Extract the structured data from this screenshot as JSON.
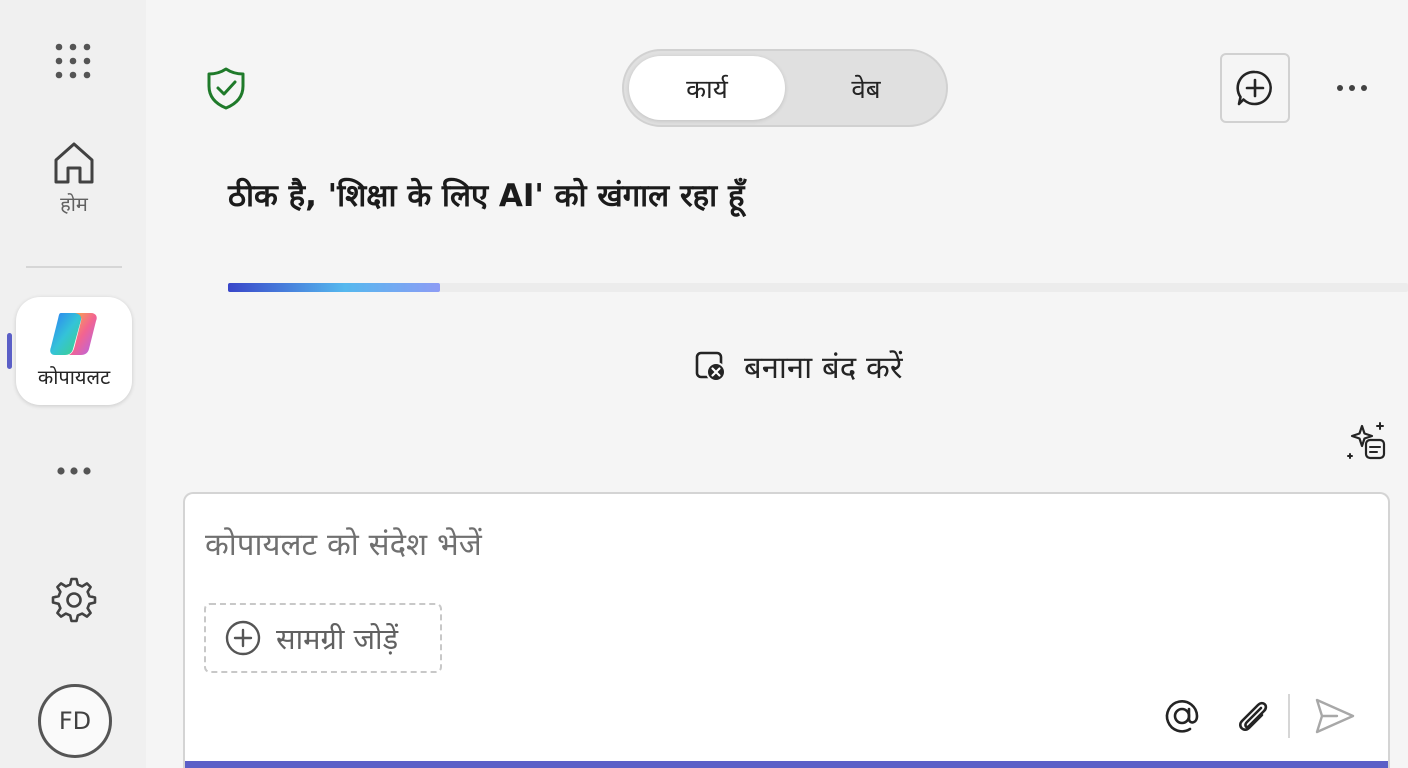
{
  "rail": {
    "home_label": "होम",
    "copilot_label": "कोपायलट",
    "avatar_initials": "FD",
    "accent_color": "#5b5fc7"
  },
  "header": {
    "tabs": [
      {
        "label": "कार्य",
        "selected": true
      },
      {
        "label": "वेब",
        "selected": false
      }
    ],
    "shield_color": "#1f7a2a"
  },
  "status": {
    "text": "ठीक है, 'शिक्षा के लिए AI' को खंगाल रहा हूँ",
    "progress_fraction": 0.18,
    "stop_label": "बनाना बंद करें"
  },
  "composer": {
    "placeholder": "कोपायलट को संदेश भेजें",
    "value": "",
    "add_content_label": "सामग्री जोड़ें"
  },
  "icons": [
    "apps-grid-icon",
    "home-icon",
    "copilot-logo-icon",
    "more-horizontal-icon",
    "settings-gear-icon",
    "shield-check-icon",
    "new-chat-icon",
    "stop-icon",
    "sparkle-notes-icon",
    "plus-circle-icon",
    "at-mention-icon",
    "paperclip-icon",
    "send-icon"
  ]
}
